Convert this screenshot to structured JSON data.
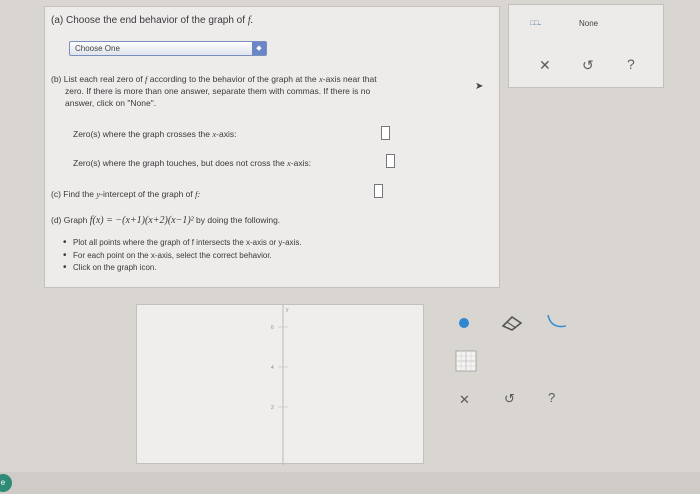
{
  "part_a": {
    "text": "(a) Choose the end behavior of the graph of",
    "fn": "f.",
    "select_value": "Choose One"
  },
  "part_b": {
    "prefix": "(b) List each real zero of",
    "fn": "f",
    "rest": "according to the behavior of the graph at the",
    "axis": "x",
    "suffix": "-axis near that",
    "line2": "zero. If there is more than one answer, separate them with commas. If there is no",
    "line3": "answer, click on \"None\".",
    "crosses_label_pre": "Zero(s) where the graph crosses the",
    "crosses_axis": "x",
    "crosses_label_post": "-axis:",
    "touches_label_pre": "Zero(s) where the graph touches, but does not cross the",
    "touches_axis": "x",
    "touches_label_post": "-axis:"
  },
  "part_c": {
    "pre": "(c) Find the",
    "axis": "y",
    "post": "-intercept of the graph of",
    "fn": "f:"
  },
  "part_d": {
    "pre": "(d) Graph",
    "equation": "f(x) = −(x+1)(x+2)(x−1)²",
    "post": "by doing the following.",
    "bullets": [
      "Plot all points where the graph of f intersects the x-axis or y-axis.",
      "For each point on the x-axis, select the correct behavior.",
      "Click on the graph icon."
    ]
  },
  "right_panel": {
    "blocks_glyph": "□.□...",
    "none_label": "None",
    "close_glyph": "✕",
    "undo_glyph": "↺",
    "help_glyph": "?"
  },
  "graph": {
    "y_axis_label": "y",
    "ticks": [
      "6",
      "4",
      "2"
    ]
  },
  "graph_tools": {
    "close_glyph": "✕",
    "undo_glyph": "↺",
    "help_glyph": "?"
  },
  "colors": {
    "accent_blue": "#2f87cf",
    "select_arrow": "#6b86c6"
  }
}
